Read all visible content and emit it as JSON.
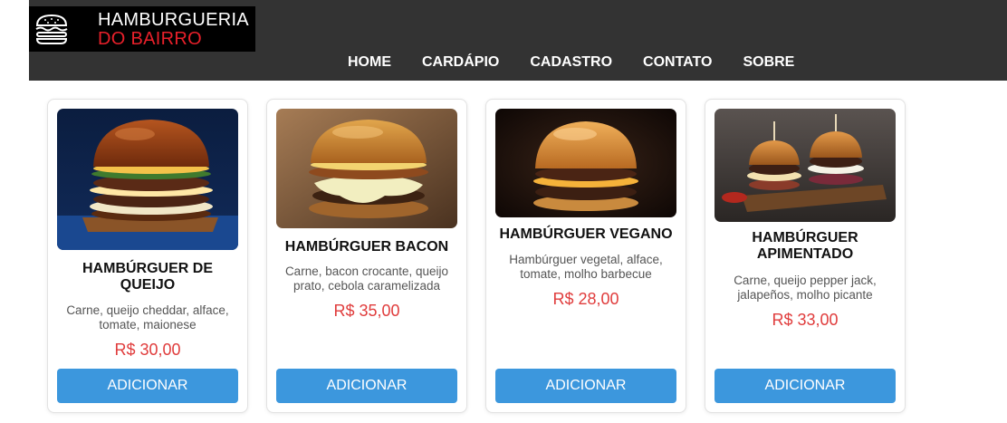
{
  "brand": {
    "line1": "HAMBURGUERIA",
    "line2": "DO BAIRRO",
    "icon": "burger-icon"
  },
  "nav": {
    "items": [
      "HOME",
      "CARDÁPIO",
      "CADASTRO",
      "CONTATO",
      "SOBRE"
    ]
  },
  "colors": {
    "header": "#333333",
    "accent_red": "#e8202a",
    "price": "#e03c3c",
    "button": "#3c97dd"
  },
  "products": [
    {
      "title": "HAMBÚRGUER DE QUEIJO",
      "description": "Carne, queijo cheddar, alface, tomate, maionese",
      "price": "R$ 30,00",
      "button": "ADICIONAR",
      "image": "cheese-burger-photo"
    },
    {
      "title": "HAMBÚRGUER BACON",
      "description": "Carne, bacon crocante, queijo prato, cebola caramelizada",
      "price": "R$ 35,00",
      "button": "ADICIONAR",
      "image": "bacon-burger-photo"
    },
    {
      "title": "HAMBÚRGUER VEGANO",
      "description": "Hambúrguer vegetal, alface, tomate, molho barbecue",
      "price": "R$ 28,00",
      "button": "ADICIONAR",
      "image": "vegan-burger-photo"
    },
    {
      "title": "HAMBÚRGUER APIMENTADO",
      "description": "Carne, queijo pepper jack, jalapeños, molho picante",
      "price": "R$ 33,00",
      "button": "ADICIONAR",
      "image": "spicy-burger-photo"
    }
  ]
}
